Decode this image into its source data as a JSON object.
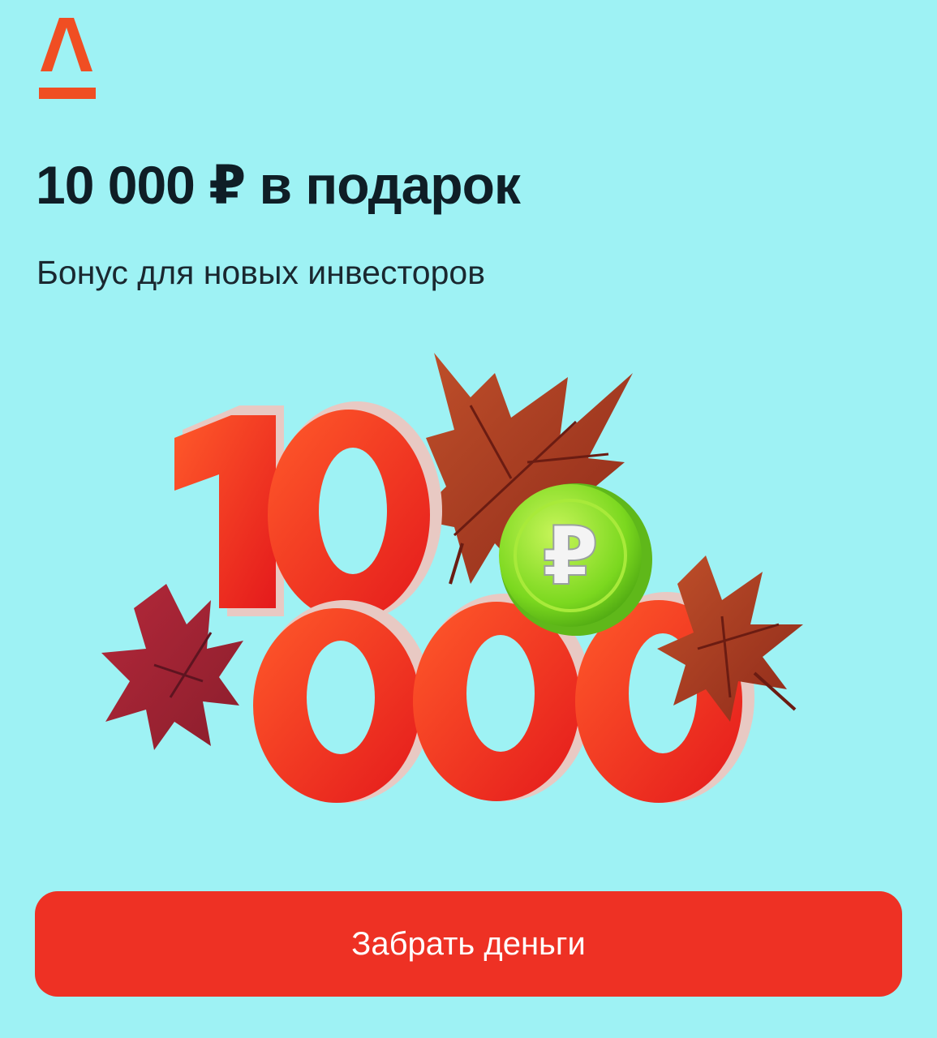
{
  "brand": {
    "logo_letter": "A",
    "logo_color": "#f04e23"
  },
  "promo": {
    "title": "10 000 ₽ в подарок",
    "subtitle": "Бонус для новых инвесторов"
  },
  "illustration": {
    "digits_top": "10",
    "digits_bottom": "000",
    "coin_symbol": "₽",
    "icon": "autumn-maple-leaves-and-coin"
  },
  "cta": {
    "label": "Забрать деньги"
  },
  "colors": {
    "background": "#9ef2f4",
    "accent": "#ee3124",
    "text": "#0f1e26",
    "coin": "#7bd81f"
  }
}
